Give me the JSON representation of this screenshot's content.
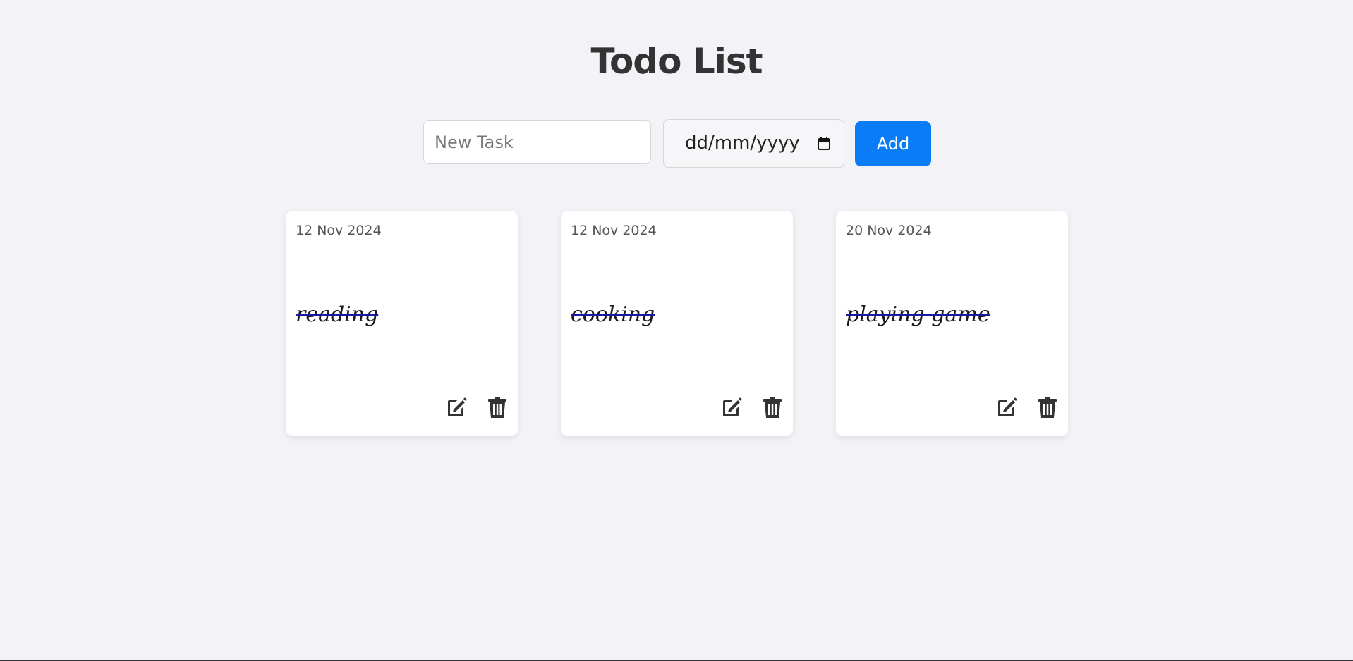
{
  "header": {
    "title": "Todo List"
  },
  "form": {
    "task_placeholder": "New Task",
    "task_value": "",
    "date_placeholder": "dd/mm/yyyy",
    "add_label": "Add"
  },
  "colors": {
    "background": "#f3f3f7",
    "accent": "#0a7df6",
    "strike": "#1a1aa0",
    "card": "#ffffff"
  },
  "tasks": [
    {
      "date": "12 Nov 2024",
      "title": "reading",
      "completed": true
    },
    {
      "date": "12 Nov 2024",
      "title": "cooking",
      "completed": true
    },
    {
      "date": "20 Nov 2024",
      "title": "playing game",
      "completed": true
    }
  ],
  "icons": {
    "edit": "edit-icon",
    "delete": "trash-icon",
    "calendar": "calendar-icon"
  }
}
